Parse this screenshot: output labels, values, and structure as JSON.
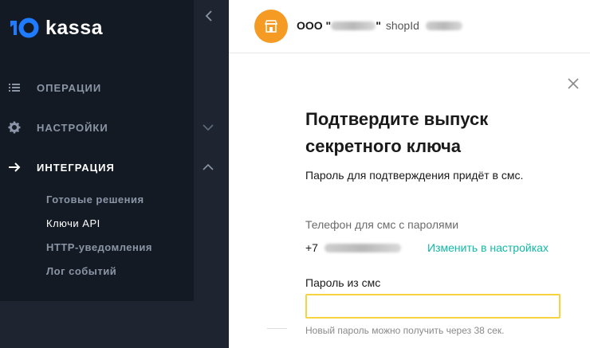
{
  "sidebar": {
    "logo_text": "kassa",
    "nav": [
      {
        "label": "Операции",
        "icon": "list-icon"
      },
      {
        "label": "Настройки",
        "icon": "gear-icon"
      },
      {
        "label": "Интеграция",
        "icon": "arrow-right-icon"
      }
    ],
    "sub_items": [
      "Готовые решения",
      "Ключи API",
      "HTTP-уведомления",
      "Лог событий"
    ],
    "active_sub": "Ключи API"
  },
  "header": {
    "org_name": "ООО \"",
    "org_name_close": "\"",
    "shop_id_label": "shopId",
    "avatar_icon": "shop-icon"
  },
  "dialog": {
    "title": "Подтвердите выпуск секретного ключа",
    "subtitle": "Пароль для подтверждения придёт в смс.",
    "phone_label": "Телефон для смс с паролями",
    "phone_prefix": "+7",
    "change_link": "Изменить в настройках",
    "password_label": "Пароль из смс",
    "password_value": "",
    "hint": "Новый пароль можно получить через 38 сек."
  },
  "colors": {
    "sidebar_bg": "#131a24",
    "accent_orange": "#f59a23",
    "link_teal": "#13b8a6",
    "input_border": "#f6d33f"
  }
}
